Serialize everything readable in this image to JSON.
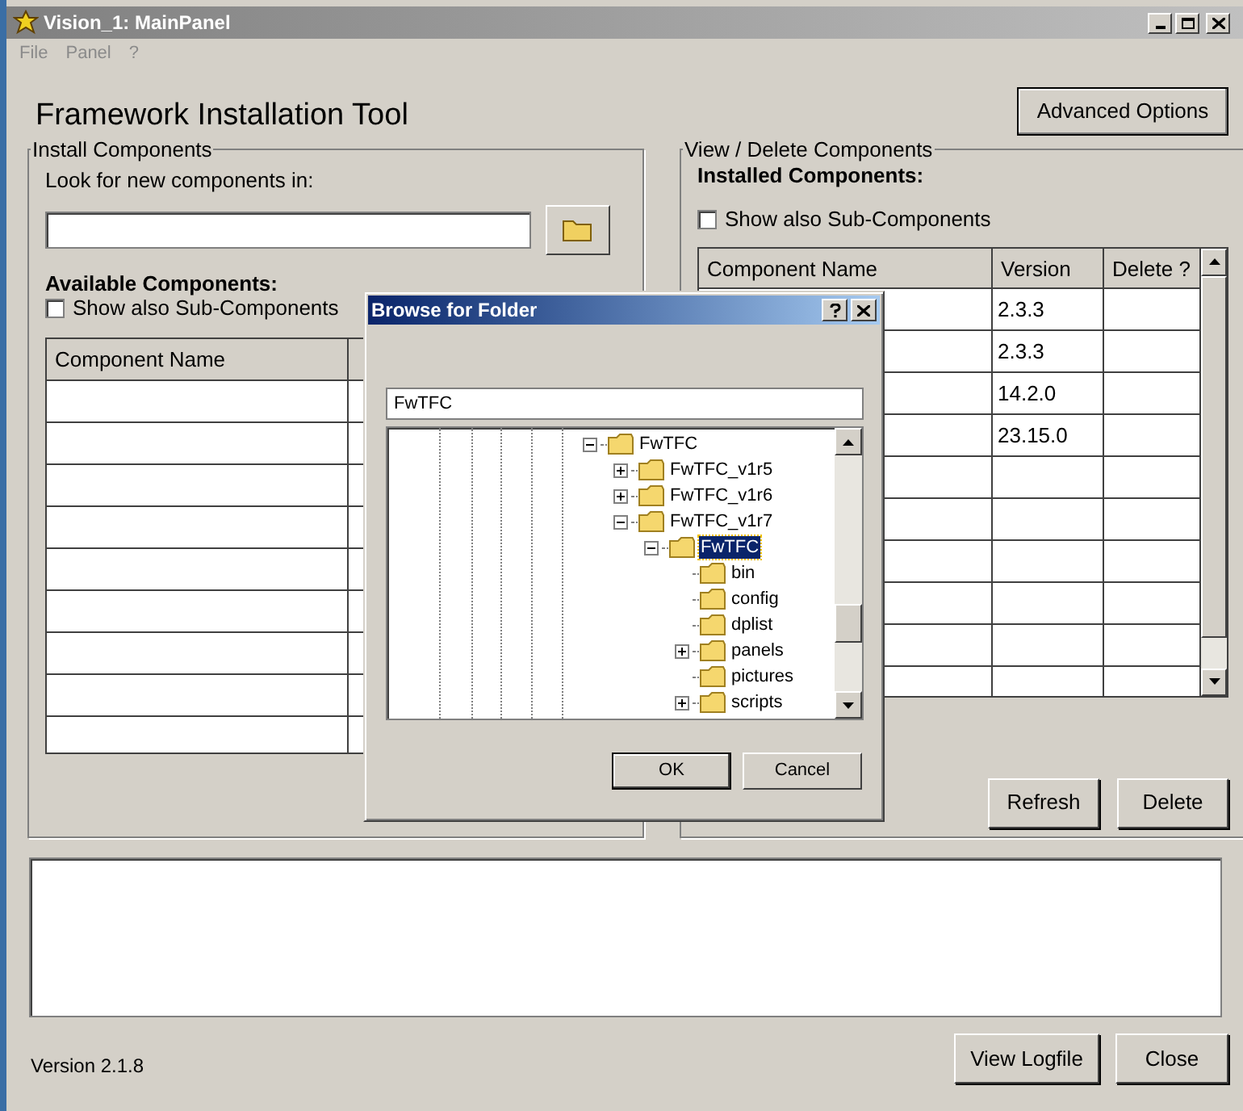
{
  "window": {
    "title": "Vision_1: MainPanel",
    "active": false
  },
  "menu": [
    {
      "label": "File",
      "disabled": true
    },
    {
      "label": "Panel",
      "disabled": true
    },
    {
      "label": "?",
      "disabled": true
    }
  ],
  "heading": "Framework Installation Tool",
  "advanced_button": "Advanced Options",
  "install_group": {
    "title": "Install Components",
    "look_label": "Look for new components in:",
    "available_label": "Available Components:",
    "sub_checkbox": {
      "label": "Show also Sub-Components",
      "checked": false
    },
    "table": {
      "columns": [
        "Component Name"
      ]
    }
  },
  "view_group": {
    "title": "View / Delete Components",
    "installed_label": "Installed Components:",
    "sub_checkbox": {
      "label": "Show also Sub-Components",
      "checked": false
    },
    "table": {
      "columns": [
        "Component Name",
        "Version",
        "Delete ?"
      ],
      "rows": [
        {
          "version": "2.3.3"
        },
        {
          "version": "2.3.3"
        },
        {
          "version": "14.2.0"
        },
        {
          "version": "23.15.0"
        }
      ]
    },
    "buttons": [
      "Refresh",
      "Delete"
    ]
  },
  "version": "Version 2.1.8",
  "footer_buttons": [
    "View Logfile",
    "Close"
  ],
  "dialog": {
    "title": "Browse for Folder",
    "path": "FwTFC",
    "buttons": [
      "OK",
      "Cancel"
    ],
    "tree": [
      {
        "label": "FwTFC",
        "expanded": true,
        "selected": false,
        "children": [
          {
            "label": "FwTFC_v1r5",
            "expanded": false,
            "selected": false
          },
          {
            "label": "FwTFC_v1r6",
            "expanded": false,
            "selected": false
          },
          {
            "label": "FwTFC_v1r7",
            "expanded": true,
            "selected": false,
            "children": [
              {
                "label": "FwTFC",
                "expanded": true,
                "selected": true,
                "children": [
                  {
                    "label": "bin",
                    "selected": false
                  },
                  {
                    "label": "config",
                    "selected": false
                  },
                  {
                    "label": "dplist",
                    "selected": false
                  },
                  {
                    "label": "panels",
                    "expanded": false,
                    "selected": false
                  },
                  {
                    "label": "pictures",
                    "selected": false
                  },
                  {
                    "label": "scripts",
                    "expanded": false,
                    "selected": false
                  }
                ]
              }
            ]
          }
        ]
      }
    ]
  }
}
